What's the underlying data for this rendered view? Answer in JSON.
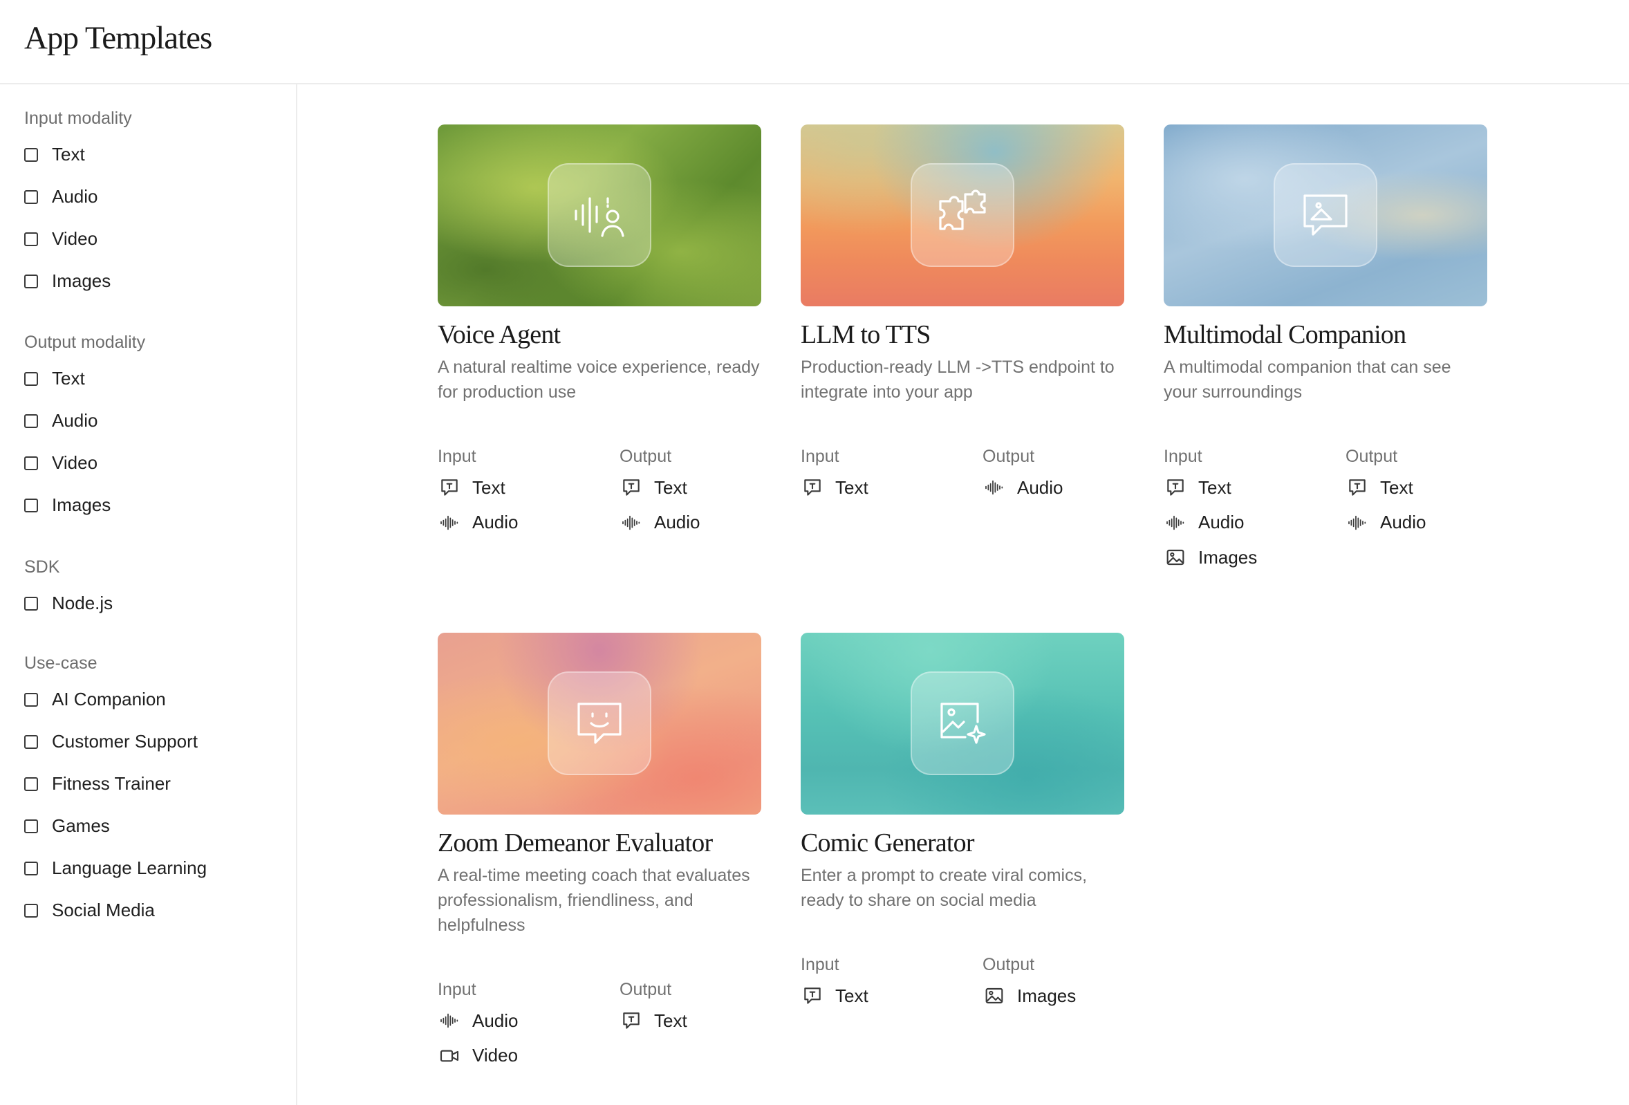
{
  "header": {
    "title": "App Templates"
  },
  "filters": [
    {
      "heading": "Input modality",
      "options": [
        "Text",
        "Audio",
        "Video",
        "Images"
      ]
    },
    {
      "heading": "Output modality",
      "options": [
        "Text",
        "Audio",
        "Video",
        "Images"
      ]
    },
    {
      "heading": "SDK",
      "options": [
        "Node.js"
      ]
    },
    {
      "heading": "Use-case",
      "options": [
        "AI Companion",
        "Customer Support",
        "Fitness Trainer",
        "Games",
        "Language Learning",
        "Social Media"
      ]
    }
  ],
  "io_labels": {
    "input": "Input",
    "output": "Output"
  },
  "cards": [
    {
      "title": "Voice Agent",
      "description": "A natural realtime voice experience, ready for production use",
      "icon": "voice-agent-icon",
      "input": [
        {
          "label": "Text",
          "icon": "text-icon"
        },
        {
          "label": "Audio",
          "icon": "audio-icon"
        }
      ],
      "output": [
        {
          "label": "Text",
          "icon": "text-icon"
        },
        {
          "label": "Audio",
          "icon": "audio-icon"
        }
      ]
    },
    {
      "title": "LLM to TTS",
      "description": "Production-ready LLM ->TTS endpoint to integrate into your app",
      "icon": "puzzle-icon",
      "input": [
        {
          "label": "Text",
          "icon": "text-icon"
        }
      ],
      "output": [
        {
          "label": "Audio",
          "icon": "audio-icon"
        }
      ]
    },
    {
      "title": "Multimodal Companion",
      "description": "A multimodal companion that can see your surroundings",
      "icon": "image-chat-icon",
      "input": [
        {
          "label": "Text",
          "icon": "text-icon"
        },
        {
          "label": "Audio",
          "icon": "audio-icon"
        },
        {
          "label": "Images",
          "icon": "image-icon"
        }
      ],
      "output": [
        {
          "label": "Text",
          "icon": "text-icon"
        },
        {
          "label": "Audio",
          "icon": "audio-icon"
        }
      ]
    },
    {
      "title": "Zoom Demeanor Evaluator",
      "description": "A real-time meeting coach that evaluates professionalism, friendliness, and helpfulness",
      "icon": "smile-chat-icon",
      "input": [
        {
          "label": "Audio",
          "icon": "audio-icon"
        },
        {
          "label": "Video",
          "icon": "video-icon"
        }
      ],
      "output": [
        {
          "label": "Text",
          "icon": "text-icon"
        }
      ]
    },
    {
      "title": "Comic Generator",
      "description": "Enter a prompt to create viral comics, ready to share on social media",
      "icon": "image-sparkle-icon",
      "input": [
        {
          "label": "Text",
          "icon": "text-icon"
        }
      ],
      "output": [
        {
          "label": "Images",
          "icon": "image-icon"
        }
      ]
    }
  ],
  "colors": {
    "text": "#1f1f1f",
    "muted": "#717171",
    "border": "#ececec"
  }
}
